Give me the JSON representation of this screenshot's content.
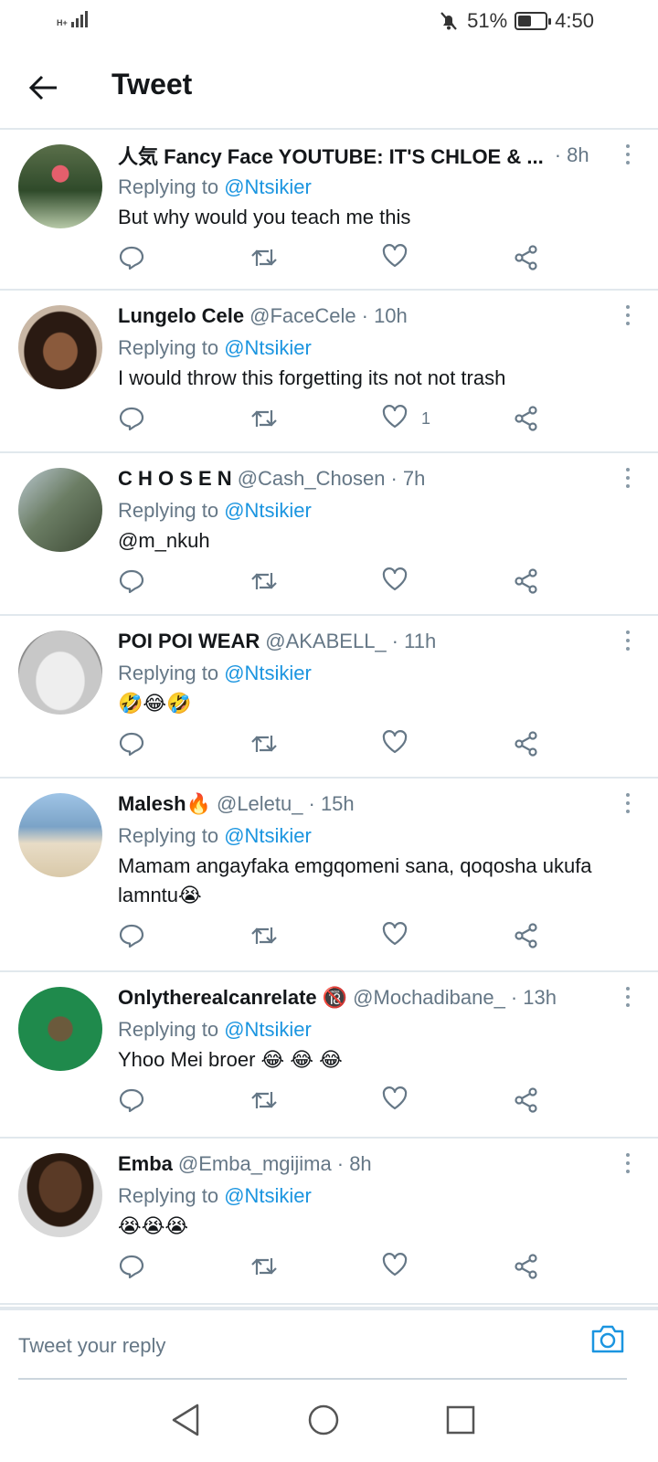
{
  "status_bar": {
    "network": "H+",
    "battery": "51%",
    "battery_level": 0.51,
    "time": "4:50"
  },
  "header": {
    "title": "Tweet"
  },
  "tweets": [
    {
      "name": "人気 Fancy Face YOUTUBE: IT'S CHLOE & ...",
      "handle": "",
      "time": "· 8h",
      "replying_label": "Replying to ",
      "replying_to": "@Ntsikier",
      "body": "But why would you teach me this",
      "body_is_mention": false,
      "likes": ""
    },
    {
      "name": "Lungelo Cele",
      "handle": "@FaceCele",
      "time": "· 10h",
      "replying_label": "Replying to ",
      "replying_to": "@Ntsikier",
      "body": "I would throw this forgetting its not not trash",
      "body_is_mention": false,
      "likes": "1"
    },
    {
      "name": "C H O S E N",
      "handle": "@Cash_Chosen",
      "time": "· 7h",
      "replying_label": "Replying to ",
      "replying_to": "@Ntsikier",
      "body": "@m_nkuh",
      "body_is_mention": true,
      "likes": ""
    },
    {
      "name": "POI POI WEAR",
      "handle": "@AKABELL_",
      "time": "· 11h",
      "replying_label": "Replying to ",
      "replying_to": "@Ntsikier",
      "body": "🤣😂🤣",
      "body_is_mention": false,
      "likes": ""
    },
    {
      "name": "Malesh🔥",
      "handle": "@Leletu_",
      "time": "· 15h",
      "replying_label": "Replying to ",
      "replying_to": "@Ntsikier",
      "body": "Mamam angayfaka emgqomeni sana, qoqosha ukufa lamntu😭",
      "body_is_mention": false,
      "likes": ""
    },
    {
      "name": "Onlytherealcanrelate 🔞",
      "handle": "@Mochadibane_",
      "time": "· 13h",
      "replying_label": "Replying to ",
      "replying_to": "@Ntsikier",
      "body": "Yhoo Mei broer 😂 😂 😂",
      "body_is_mention": false,
      "likes": ""
    },
    {
      "name": "Emba",
      "handle": "@Emba_mgijima",
      "time": "· 8h",
      "replying_label": "Replying to ",
      "replying_to": "@Ntsikier",
      "body": "😭😭😭",
      "body_is_mention": false,
      "likes": ""
    }
  ],
  "reply_bar": {
    "placeholder": "Tweet your reply"
  },
  "colors": {
    "accent": "#1b95e0",
    "secondary_text": "#657786",
    "divider": "#e1e8ed"
  },
  "icons": [
    "back-arrow-icon",
    "reply-icon",
    "retweet-icon",
    "like-icon",
    "share-icon",
    "more-icon",
    "camera-icon",
    "nav-back-icon",
    "nav-home-icon",
    "nav-recents-icon"
  ]
}
